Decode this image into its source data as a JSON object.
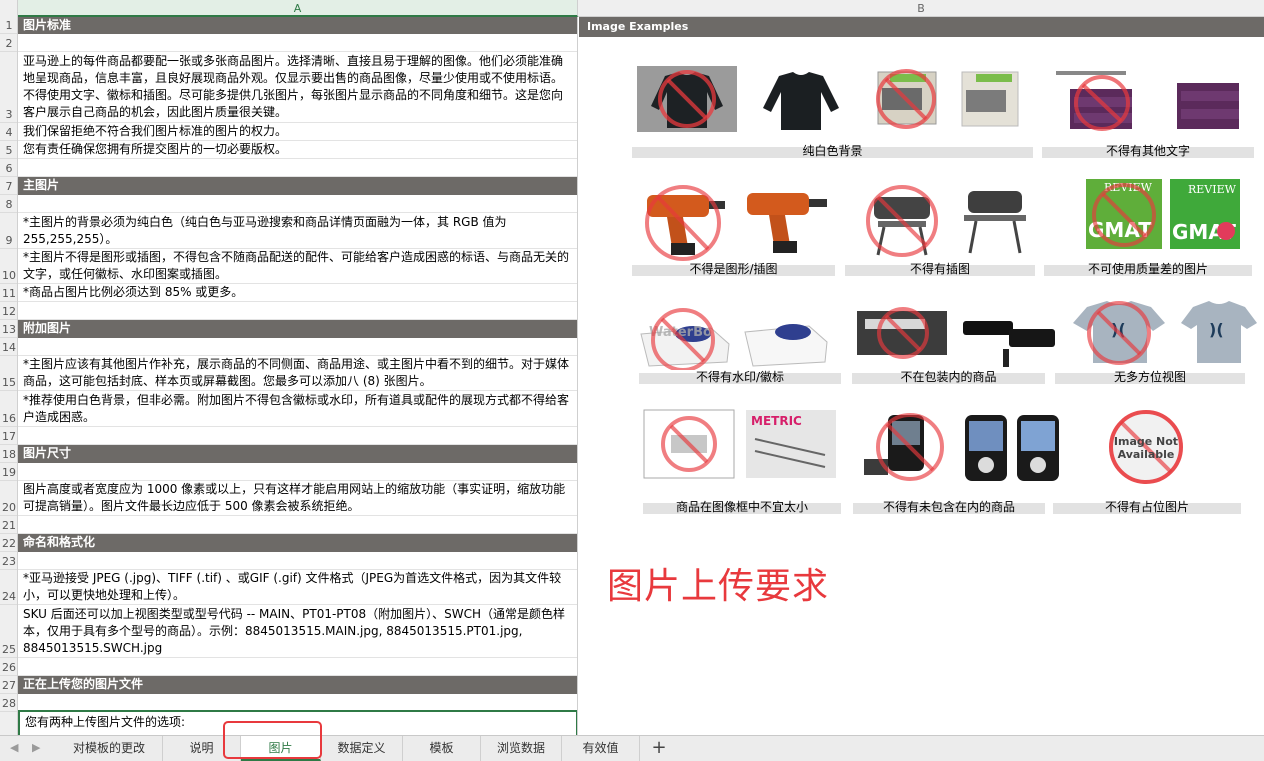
{
  "columns": {
    "a": "A",
    "b": "B"
  },
  "rows": [
    "1",
    "2",
    "3",
    "4",
    "5",
    "6",
    "7",
    "8",
    "9",
    "10",
    "11",
    "12",
    "13",
    "14",
    "15",
    "16",
    "17",
    "18",
    "19",
    "20",
    "21",
    "22",
    "23",
    "24",
    "25",
    "26",
    "27",
    "28"
  ],
  "sheet": {
    "r1": "图片标准",
    "r3": "亚马逊上的每件商品都要配一张或多张商品图片。选择清晰、直接且易于理解的图像。他们必须能准确地呈现商品，信息丰富，且良好展现商品外观。仅显示要出售的商品图像，尽量少使用或不使用标语。不得使用文字、徽标和插图。尽可能多提供几张图片，每张图片显示商品的不同角度和细节。这是您向客户展示自己商品的机会，因此图片质量很关键。",
    "r4": "我们保留拒绝不符合我们图片标准的图片的权力。",
    "r5": "您有责任确保您拥有所提交图片的一切必要版权。",
    "r7": "主图片",
    "r9": "*主图片的背景必须为纯白色（纯白色与亚马逊搜索和商品详情页面融为一体，其 RGB 值为255,255,255）。",
    "r10": "*主图片不得是图形或插图，不得包含不随商品配送的配件、可能给客户造成困惑的标语、与商品无关的文字，或任何徽标、水印图案或插图。",
    "r11": "*商品占图片比例必须达到 85% 或更多。",
    "r13": "附加图片",
    "r15": "*主图片应该有其他图片作补充，展示商品的不同侧面、商品用途、或主图片中看不到的细节。对于媒体商品，这可能包括封底、样本页或屏幕截图。您最多可以添加八 (8) 张图片。",
    "r16": "*推荐使用白色背景，但非必需。附加图片不得包含徽标或水印，所有道具或配件的展现方式都不得给客户造成困惑。",
    "r18": "图片尺寸",
    "r20": "图片高度或者宽度应为 1000 像素或以上，只有这样才能启用网站上的缩放功能（事实证明，缩放功能可提高销量）。图片文件最长边应低于 500 像素会被系统拒绝。",
    "r22": "命名和格式化",
    "r24": "*亚马逊接受 JPEG (.jpg)、TIFF (.tif) 、或GIF (.gif) 文件格式（JPEG为首选文件格式，因为其文件较小，可以更快地处理和上传）。",
    "r25": "*我们建议的图片文件命名方式是，用商品 SKU 作为文件名将图片保存在您的网站服务器上，在商品 SKU 后面还可以加上视图类型或型号代码 -- MAIN、PT01-PT08（附加图片）、SWCH（通常是颜色样本，仅用于具有多个型号的商品）。示例：8845013515.MAIN.jpg, 8845013515.PT01.jpg, 8845013515.SWCH.jpg",
    "r27": "正在上传您的图片文件",
    "r28": "您有两种上传图片文件的选项:"
  },
  "examples": {
    "header": "Image Examples",
    "captions": {
      "white_bg": "纯白色背景",
      "no_text": "不得有其他文字",
      "no_graphic": "不得是图形/插图",
      "no_illustration": "不得有插图",
      "no_low_quality": "不可使用质量差的图片",
      "no_watermark": "不得有水印/徽标",
      "not_in_package": "不在包装内的商品",
      "no_multi_view": "无多方位视图",
      "not_too_small": "商品在图像框中不宜太小",
      "no_extra_items": "不得有未包含在内的商品",
      "no_placeholder": "不得有占位图片"
    },
    "thumb_texts": {
      "review": "REVIEW",
      "gmat": "GMAT",
      "watermark": "WaterBo",
      "metric": "METRIC",
      "not_available_line1": "Image Not",
      "not_available_line2": "Available"
    },
    "overlay_title": "图片上传要求"
  },
  "tabs": [
    "对模板的更改",
    "说明",
    "图片",
    "数据定义",
    "模板",
    "浏览数据",
    "有效值"
  ],
  "active_tab": "图片",
  "add_tab_label": "+",
  "nav": {
    "prev": "◀",
    "next": "▶"
  },
  "colors": {
    "accent": "#2f7a46",
    "header_bg": "#6d6a67",
    "highlight": "#e8393d",
    "prohibit": "#e8393d"
  }
}
